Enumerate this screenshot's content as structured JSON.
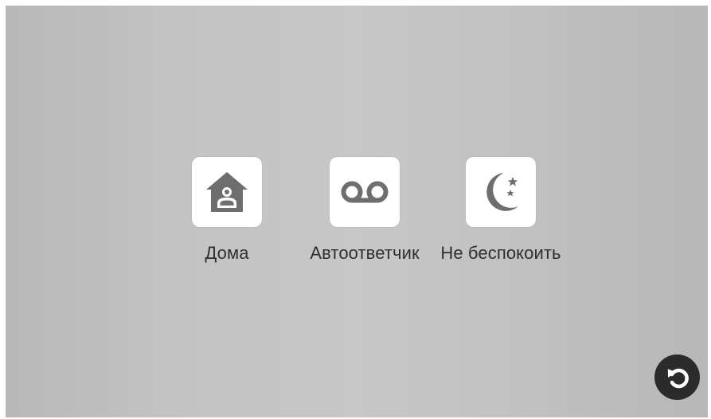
{
  "modes": [
    {
      "label": "Дома",
      "icon": "home-person-icon"
    },
    {
      "label": "Автоответчик",
      "icon": "voicemail-icon"
    },
    {
      "label": "Не беспокоить",
      "icon": "moon-stars-icon"
    }
  ],
  "back_button": {
    "icon": "undo-arrow-icon"
  },
  "colors": {
    "icon": "#6e6e6e",
    "tile": "#ffffff",
    "label": "#2f2f2f",
    "back_button_bg": "#2b2b2b",
    "back_button_icon": "#ffffff"
  }
}
